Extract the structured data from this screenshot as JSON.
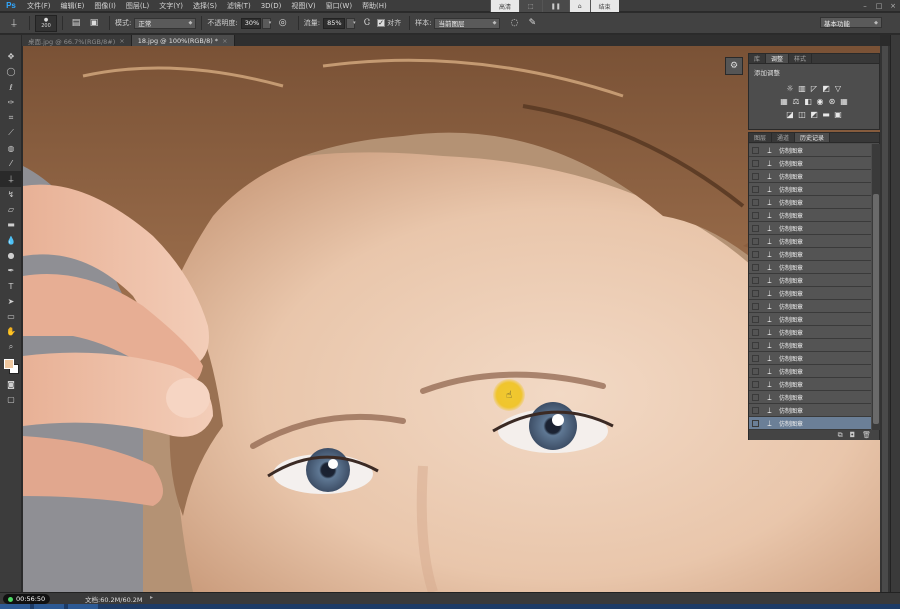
{
  "app": {
    "logo": "Ps"
  },
  "menu": {
    "items": [
      "文件(F)",
      "编辑(E)",
      "图像(I)",
      "图层(L)",
      "文字(Y)",
      "选择(S)",
      "滤镜(T)",
      "3D(D)",
      "视图(V)",
      "窗口(W)",
      "帮助(H)"
    ],
    "center": [
      "高清",
      "",
      "",
      "",
      "结束"
    ]
  },
  "options": {
    "brush_size": "200",
    "mode_label": "模式:",
    "mode_value": "正常",
    "opacity_label": "不透明度:",
    "opacity_value": "30%",
    "flow_label": "流量:",
    "flow_value": "85%",
    "align_label": "对齐",
    "sample_label": "样本:",
    "sample_value": "当前图层",
    "workspace": "基本功能"
  },
  "tabs": [
    {
      "label": "桌面.jpg @ 66.7%(RGB/8#)",
      "close": "×",
      "active": false
    },
    {
      "label": "18.jpg @ 100%(RGB/8) *",
      "close": "×",
      "active": true
    }
  ],
  "tools": [
    "move-tool",
    "marquee-tool",
    "lasso-tool",
    "quick-select-tool",
    "crop-tool",
    "eyedropper-tool",
    "healing-tool",
    "brush-tool",
    "clone-stamp-tool",
    "history-brush-tool",
    "eraser-tool",
    "gradient-tool",
    "blur-tool",
    "dodge-tool",
    "pen-tool",
    "type-tool",
    "path-select-tool",
    "shape-tool",
    "hand-tool",
    "zoom-tool"
  ],
  "colors": {
    "foreground": "#f0c8a0",
    "background": "#ffffff",
    "selection": "#6b7f97",
    "cursor": "#f0c328"
  },
  "adjust_panel": {
    "tabs": [
      "库",
      "调整",
      "样式"
    ],
    "active_tab": "调整",
    "title": "添加调整"
  },
  "history_panel": {
    "tabs": [
      "图层",
      "通道",
      "历史记录"
    ],
    "active_tab": "历史记录",
    "items": [
      "仿制图章",
      "仿制图章",
      "仿制图章",
      "仿制图章",
      "仿制图章",
      "仿制图章",
      "仿制图章",
      "仿制图章",
      "仿制图章",
      "仿制图章",
      "仿制图章",
      "仿制图章",
      "仿制图章",
      "仿制图章",
      "仿制图章",
      "仿制图章",
      "仿制图章",
      "仿制图章",
      "仿制图章",
      "仿制图章",
      "仿制图章",
      "仿制图章"
    ],
    "selected_index": 21
  },
  "status": {
    "timer": "00:56:50",
    "doc_info": "文档:60.2M/60.2M"
  }
}
